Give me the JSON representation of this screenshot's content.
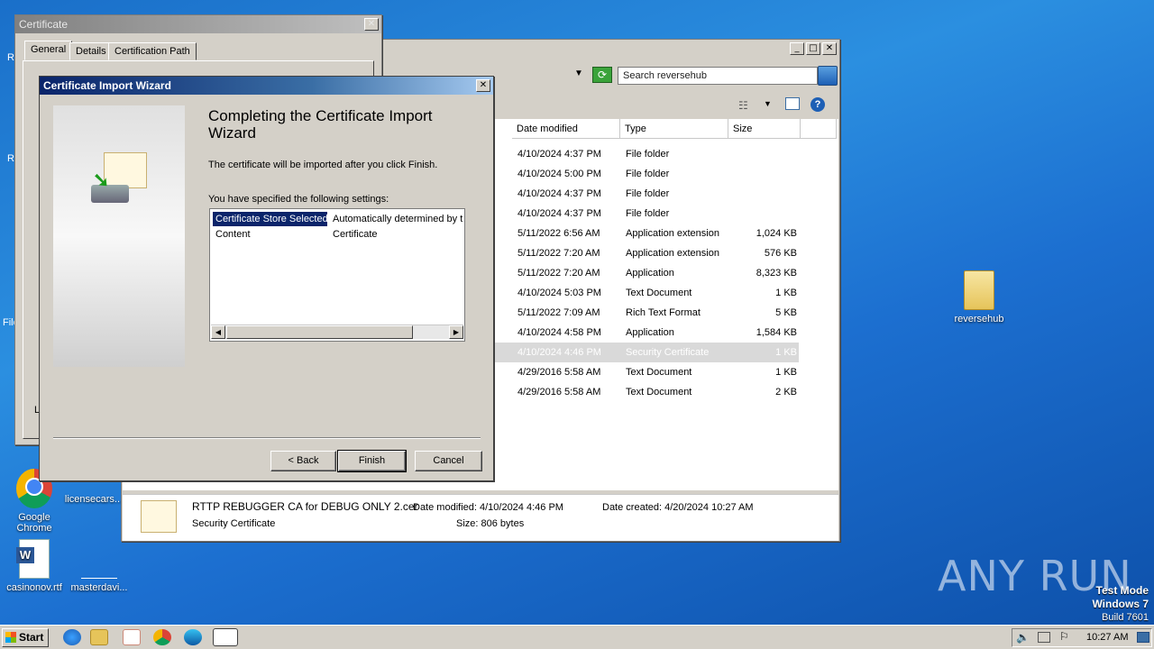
{
  "desktop": {
    "icons": [
      {
        "label": "Google Chrome"
      },
      {
        "label": "licensecars..."
      },
      {
        "label": "casinonov.rtf"
      },
      {
        "label": "masterdavi..."
      },
      {
        "label": "reversehub"
      }
    ],
    "partial_labels": {
      "r1": "R",
      "r2": "R",
      "file": "File",
      "le": "Le"
    },
    "watermark": "ANY RUN",
    "test_mode": {
      "line1": "Test Mode",
      "line2": "Windows 7",
      "line3": "Build 7601"
    }
  },
  "explorer": {
    "search_placeholder": "Search reversehub",
    "columns": {
      "date": "Date modified",
      "type": "Type",
      "size": "Size"
    },
    "rows": [
      {
        "date": "4/10/2024 4:37 PM",
        "type": "File folder",
        "size": ""
      },
      {
        "date": "4/10/2024 5:00 PM",
        "type": "File folder",
        "size": ""
      },
      {
        "date": "4/10/2024 4:37 PM",
        "type": "File folder",
        "size": ""
      },
      {
        "date": "4/10/2024 4:37 PM",
        "type": "File folder",
        "size": ""
      },
      {
        "date": "5/11/2022 6:56 AM",
        "type": "Application extension",
        "size": "1,024 KB"
      },
      {
        "date": "5/11/2022 7:20 AM",
        "type": "Application extension",
        "size": "576 KB"
      },
      {
        "date": "5/11/2022 7:20 AM",
        "type": "Application",
        "size": "8,323 KB"
      },
      {
        "date": "4/10/2024 5:03 PM",
        "type": "Text Document",
        "size": "1 KB"
      },
      {
        "date": "5/11/2022 7:09 AM",
        "type": "Rich Text Format",
        "size": "5 KB"
      },
      {
        "date": "4/10/2024 4:58 PM",
        "type": "Application",
        "size": "1,584 KB"
      },
      {
        "date": "4/10/2024 4:46 PM",
        "type": "Security Certificate",
        "size": "1 KB"
      },
      {
        "date": "4/29/2016 5:58 AM",
        "type": "Text Document",
        "size": "1 KB"
      },
      {
        "date": "4/29/2016 5:58 AM",
        "type": "Text Document",
        "size": "2 KB"
      }
    ],
    "details": {
      "filename": "RTTP REBUGGER CA for DEBUG ONLY 2.cer",
      "filetype": "Security Certificate",
      "date_modified": "Date modified:  4/10/2024 4:46 PM",
      "date_created": "Date created:  4/20/2024 10:27 AM",
      "size": "Size:  806 bytes"
    }
  },
  "certificate": {
    "title": "Certificate",
    "tabs": [
      "General",
      "Details",
      "Certification Path"
    ]
  },
  "wizard": {
    "title": "Certificate Import Wizard",
    "heading": "Completing the Certificate Import Wizard",
    "info": "The certificate will be imported after you click Finish.",
    "settings_label": "You have specified the following settings:",
    "settings": [
      {
        "key": "Certificate Store Selected",
        "value": "Automatically determined by t"
      },
      {
        "key": "Content",
        "value": "Certificate"
      }
    ],
    "buttons": {
      "back": "< Back",
      "finish": "Finish",
      "cancel": "Cancel"
    }
  },
  "taskbar": {
    "start": "Start",
    "clock": "10:27 AM"
  }
}
